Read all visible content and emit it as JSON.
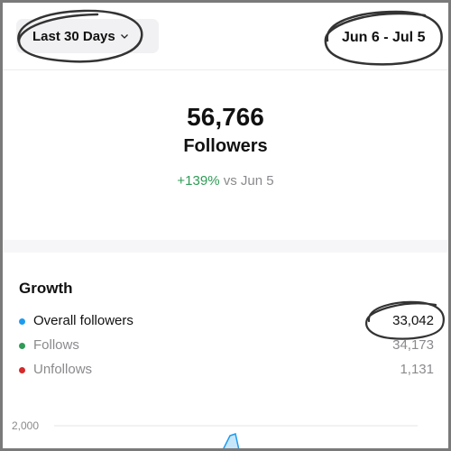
{
  "header": {
    "range_label": "Last 30 Days",
    "date_range": "Jun 6 - Jul 5"
  },
  "summary": {
    "total": "56,766",
    "label": "Followers",
    "delta": "+139%",
    "comparison": "vs Jun 5"
  },
  "growth": {
    "title": "Growth",
    "rows": [
      {
        "label": "Overall followers",
        "value": "33,042",
        "color": "#1d9bf0"
      },
      {
        "label": "Follows",
        "value": "34,173",
        "color": "#2e9b56"
      },
      {
        "label": "Unfollows",
        "value": "1,131",
        "color": "#d42a2a"
      }
    ]
  },
  "chart": {
    "y_tick": "2,000",
    "line_color": "#1d9bf0"
  }
}
